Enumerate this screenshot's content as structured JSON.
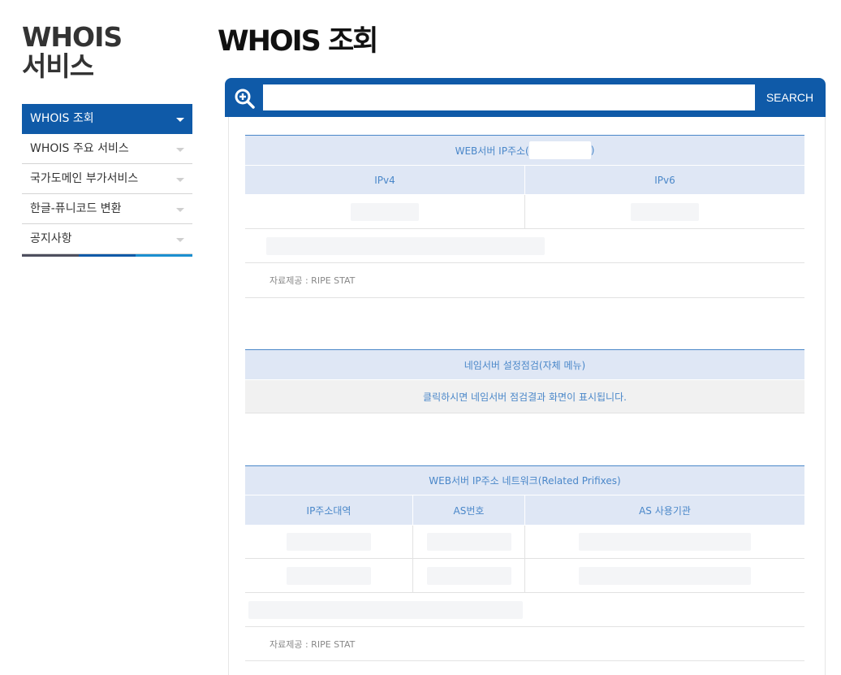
{
  "sidebar": {
    "title_line1": "WHOIS",
    "title_line2": "서비스",
    "items": [
      {
        "label": "WHOIS 조회",
        "active": true
      },
      {
        "label": "WHOIS 주요 서비스",
        "active": false
      },
      {
        "label": "국가도메인 부가서비스",
        "active": false
      },
      {
        "label": "한글-퓨니코드 변환",
        "active": false
      },
      {
        "label": "공지사항",
        "active": false
      }
    ],
    "bar_colors": [
      "#4d4f5e",
      "#0f5aa8",
      "#1b8fd0"
    ]
  },
  "page": {
    "title": "WHOIS 조회"
  },
  "search": {
    "button_label": "SEARCH",
    "value": ""
  },
  "webserver": {
    "title_prefix": "WEB서버 IP주소(",
    "title_suffix": ")",
    "col_ipv4": "IPv4",
    "col_ipv6": "IPv6",
    "source": "자료제공 : RIPE STAT"
  },
  "nameserver": {
    "title": "네임서버 설정점검(자체 메뉴)",
    "notice": "클릭하시면 네임서버 점검결과 화면이 표시됩니다."
  },
  "network": {
    "title": "WEB서버 IP주소 네트워크(Related Prifixes)",
    "col_range": "IP주소대역",
    "col_as": "AS번호",
    "col_org": "AS 사용기관",
    "source": "자료제공 : RIPE STAT"
  },
  "colors": {
    "accent": "#0f5aa8",
    "header_bg": "#dfe7f5",
    "header_text": "#4a87c9"
  }
}
